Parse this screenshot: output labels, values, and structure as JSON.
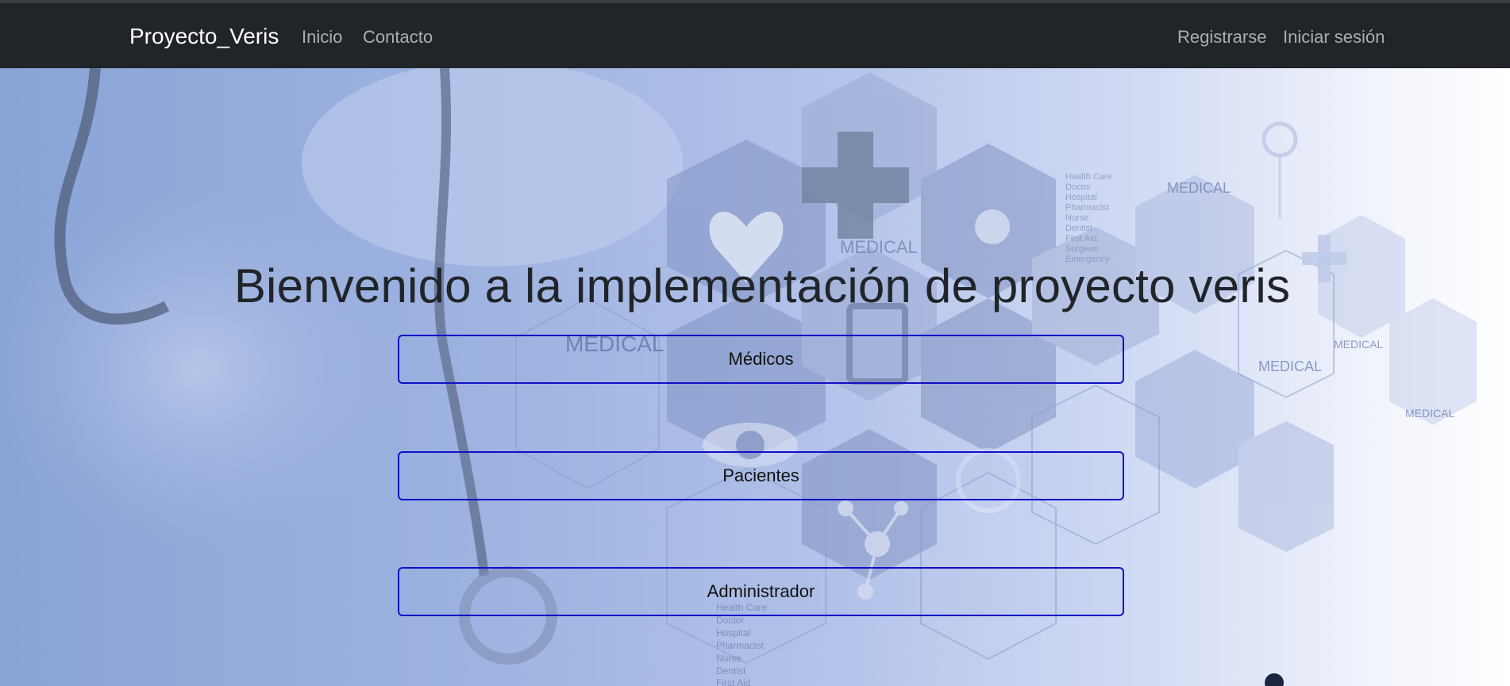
{
  "navbar": {
    "brand": "Proyecto_Veris",
    "links": [
      "Inicio",
      "Contacto"
    ],
    "right_links": [
      "Registrarse",
      "Iniciar sesión"
    ]
  },
  "hero": {
    "title": "Bienvenido a la implementación de proyecto veris",
    "buttons": [
      "Médicos",
      "Pacientes",
      "Administrador"
    ]
  },
  "background_text": {
    "medical": "MEDICAL",
    "health_list": [
      "Health Care",
      "Doctor",
      "Hospital",
      "Pharmacist",
      "Nurse",
      "Dentist",
      "First Aid",
      "Surgeon",
      "Emergency"
    ]
  },
  "colors": {
    "navbar_bg": "#212529",
    "button_border": "#1010c8",
    "title_text": "#212529"
  }
}
